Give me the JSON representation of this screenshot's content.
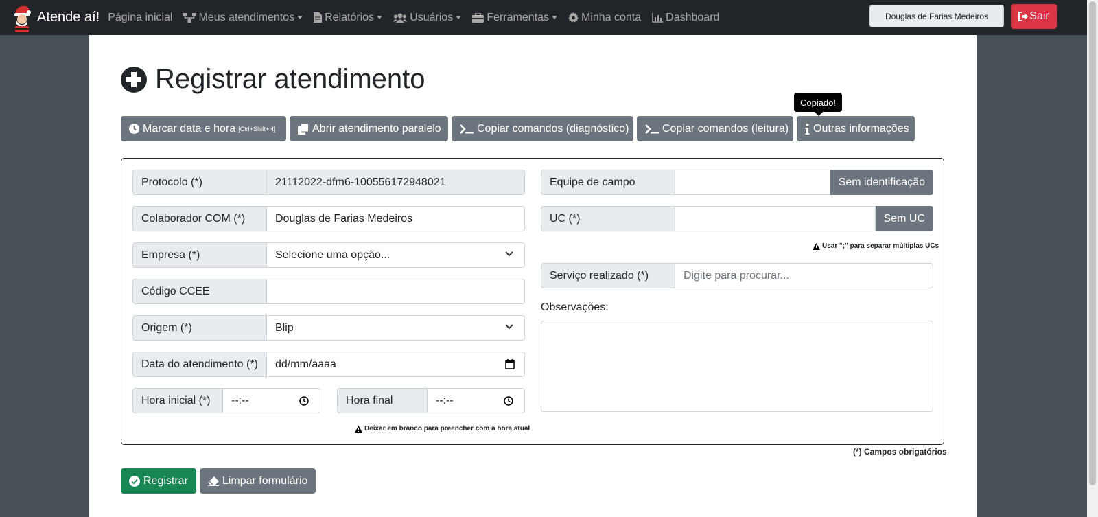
{
  "app": {
    "brand": "Atende aí!",
    "nav": [
      {
        "label": "Página inicial",
        "icon": "",
        "dropdown": false
      },
      {
        "label": "Meus atendimentos",
        "icon": "network-icon",
        "dropdown": true
      },
      {
        "label": "Relatórios",
        "icon": "file-icon",
        "dropdown": true
      },
      {
        "label": "Usuários",
        "icon": "users-icon",
        "dropdown": true
      },
      {
        "label": "Ferramentas",
        "icon": "toolbox-icon",
        "dropdown": true
      },
      {
        "label": "Minha conta",
        "icon": "gear-icon",
        "dropdown": false
      },
      {
        "label": "Dashboard",
        "icon": "chart-icon",
        "dropdown": false
      }
    ],
    "user": "Douglas de Farias Medeiros",
    "logout": "Sair"
  },
  "page": {
    "title": "Registrar atendimento",
    "toolbar": {
      "mark_time": "Marcar data e hora",
      "mark_time_shortcut": "[Ctrl+Shift+H]",
      "parallel": "Abrir atendimento paralelo",
      "copy_diag": "Copiar comandos (diagnóstico)",
      "copy_read": "Copiar comandos (leitura)",
      "other_info": "Outras informações"
    },
    "tooltip": "Copiado!"
  },
  "form": {
    "protocolo": {
      "label": "Protocolo (*)",
      "value": "21112022-dfm6-100556172948021"
    },
    "colaborador": {
      "label": "Colaborador COM (*)",
      "value": "Douglas de Farias Medeiros"
    },
    "empresa": {
      "label": "Empresa (*)",
      "value": "Selecione uma opção..."
    },
    "codigo_ccee": {
      "label": "Código CCEE",
      "value": ""
    },
    "origem": {
      "label": "Origem (*)",
      "value": "Blip"
    },
    "data": {
      "label": "Data do atendimento (*)",
      "value": "dd/mm/aaaa"
    },
    "hora_inicial": {
      "label": "Hora inicial (*)",
      "value": "--:--"
    },
    "hora_final": {
      "label": "Hora final",
      "value": "--:--"
    },
    "hint_hora": "Deixar em branco para preencher com a hora atual",
    "equipe": {
      "label": "Equipe de campo",
      "value": "",
      "button": "Sem identificação"
    },
    "uc": {
      "label": "UC (*)",
      "value": "",
      "button": "Sem UC"
    },
    "hint_uc": "Usar \";\" para separar múltiplas UCs",
    "servico": {
      "label": "Serviço realizado (*)",
      "placeholder": "Digite para procurar..."
    },
    "observacoes": {
      "label": "Observações:",
      "value": ""
    },
    "required_note": "(*) Campos obrigatórios"
  },
  "actions": {
    "submit": "Registrar",
    "clear": "Limpar formulário"
  },
  "colors": {
    "navbar": "#212529",
    "secondary": "#6c757d",
    "success": "#198754",
    "danger": "#dc3545"
  }
}
